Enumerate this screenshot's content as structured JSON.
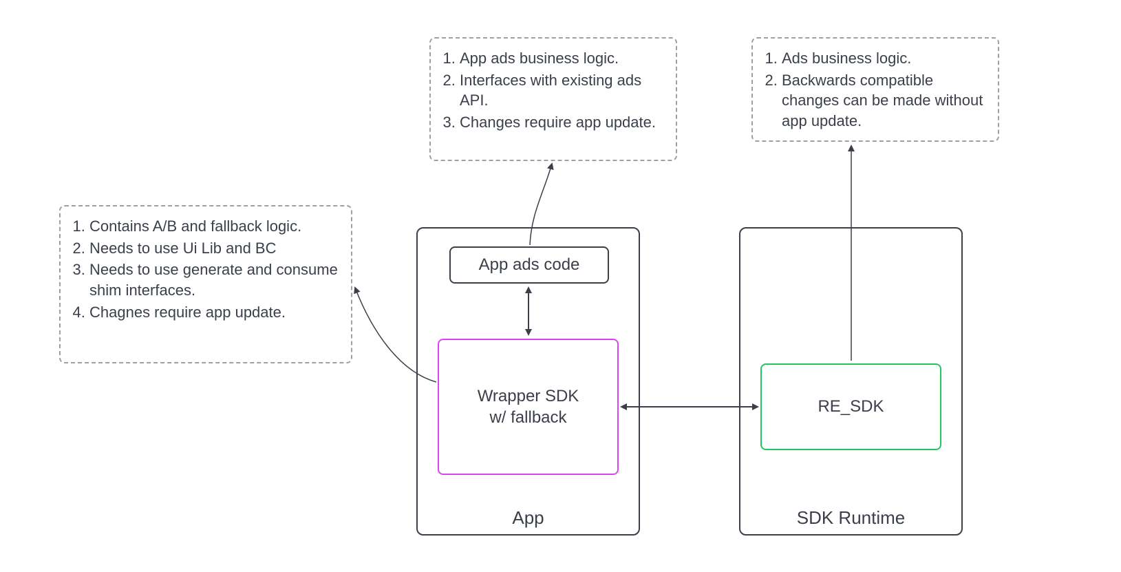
{
  "notes": {
    "wrapper": {
      "items": [
        "Contains A/B and fallback logic.",
        "Needs to use Ui Lib and BC",
        "Needs to use generate and consume shim interfaces.",
        "Chagnes require app update."
      ]
    },
    "app_ads": {
      "items": [
        "App ads business logic.",
        "Interfaces with existing ads API.",
        "Changes require app update."
      ]
    },
    "re_sdk": {
      "items": [
        "Ads business logic.",
        "Backwards compatible changes can be made without app update."
      ]
    }
  },
  "containers": {
    "app": {
      "label": "App"
    },
    "runtime": {
      "label": "SDK Runtime"
    }
  },
  "nodes": {
    "app_ads_code": {
      "label": "App ads code"
    },
    "wrapper_sdk": {
      "line1": "Wrapper SDK",
      "line2": "w/ fallback"
    },
    "re_sdk": {
      "label": "RE_SDK"
    }
  },
  "colors": {
    "stroke": "#3a3f4a",
    "dash": "#9aa0a8",
    "magenta": "#d946ef",
    "green": "#22c55e"
  }
}
